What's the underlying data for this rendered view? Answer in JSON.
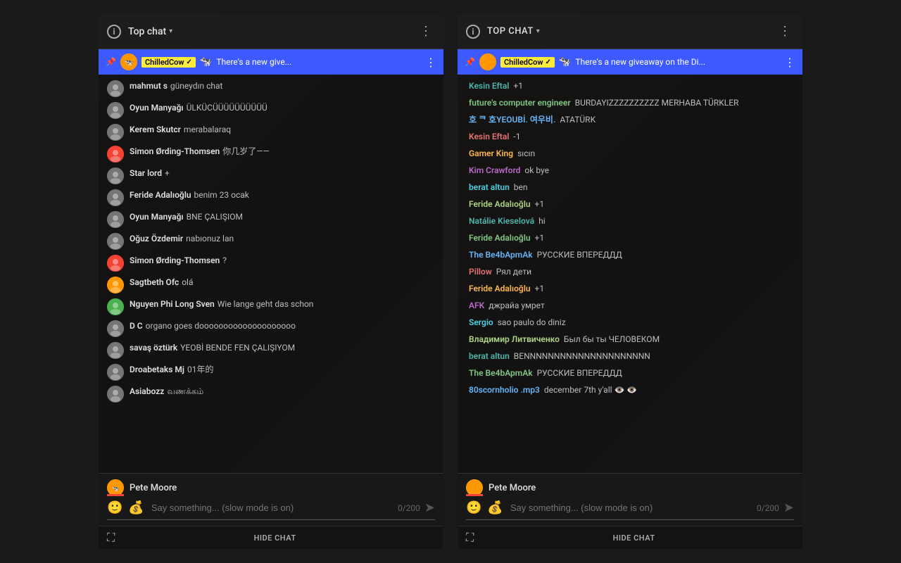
{
  "panel1": {
    "header": {
      "title": "Top chat",
      "dropdown_arrow": "▾",
      "more_dots": "⋮"
    },
    "pinned": {
      "name": "ChilledCow",
      "checkmark": "✓",
      "text": "There's a new give...",
      "emoji": "🐄"
    },
    "messages": [
      {
        "username": "mahmut s",
        "text": "güneydın chat",
        "av_class": "av-gray"
      },
      {
        "username": "Oyun Manyağı",
        "text": "ÜLKÜCÜÜÜÜÜÜÜÜÜÜ",
        "av_class": "av-gray"
      },
      {
        "username": "Kerem Skutcr",
        "text": "merabalaraq",
        "av_class": "av-gray"
      },
      {
        "username": "Simon Ørding-Thomsen",
        "text": "你几岁了——",
        "av_class": "av-red"
      },
      {
        "username": "Star lord",
        "text": "+",
        "av_class": "av-gray"
      },
      {
        "username": "Feride Adalıoğlu",
        "text": "benim 23 ocak",
        "av_class": "av-gray"
      },
      {
        "username": "Oyun Manyağı",
        "text": "BNE ÇALIŞIOM",
        "av_class": "av-gray"
      },
      {
        "username": "Oğuz Özdemir",
        "text": "nabıonuz lan",
        "av_class": "av-gray"
      },
      {
        "username": "Simon Ørding-Thomsen",
        "text": "?",
        "av_class": "av-red"
      },
      {
        "username": "Sagtbeth Ofc",
        "text": "olá",
        "av_class": "av-orange"
      },
      {
        "username": "Nguyen Phi Long Sven",
        "text": "Wie lange geht das schon",
        "av_class": "av-green"
      },
      {
        "username": "D C",
        "text": "organo goes doooooooooooooooooooo",
        "av_class": "av-gray"
      },
      {
        "username": "savaş öztürk",
        "text": "YEOBİ BENDE FEN ÇALIŞIYOM",
        "av_class": "av-gray"
      },
      {
        "username": "Droabetaks Mj",
        "text": "01年的",
        "av_class": "av-gray"
      },
      {
        "username": "Asiabozz",
        "text": "வணக்கம்",
        "av_class": "av-gray"
      }
    ],
    "input": {
      "username": "Pete Moore",
      "placeholder": "Say something... (slow mode is on)",
      "char_count": "0/200"
    },
    "hide_chat": "HIDE CHAT"
  },
  "panel2": {
    "header": {
      "title": "TOP CHAT",
      "dropdown_arrow": "▾",
      "more_dots": "⋮"
    },
    "pinned": {
      "name": "ChilledCow",
      "checkmark": "✓",
      "text": "There's a new giveaway on the Di...",
      "emoji": "🐄"
    },
    "messages": [
      {
        "username": "Kesin Eftal",
        "text": "+1",
        "av_class": null
      },
      {
        "username": "future's computer engineer",
        "text": "BURDAYIZZZZZZZZZZ MERHABA TÜRKLER",
        "av_class": null
      },
      {
        "username": "호 ᄏ 호YEOUBİ. 여우비.",
        "text": "ATATÜRK",
        "av_class": null
      },
      {
        "username": "Kesin Eftal",
        "text": "-1",
        "av_class": null
      },
      {
        "username": "Gamer King",
        "text": "sıcın",
        "av_class": null
      },
      {
        "username": "Kim Crawford",
        "text": "ok bye",
        "av_class": null
      },
      {
        "username": "berat altun",
        "text": "ben",
        "av_class": null
      },
      {
        "username": "Feride Adalıoğlu",
        "text": "+1",
        "av_class": null
      },
      {
        "username": "Natálie Kieselová",
        "text": "hi",
        "av_class": null
      },
      {
        "username": "Feride Adalıoğlu",
        "text": "+1",
        "av_class": null
      },
      {
        "username": "The Be4bApmAk",
        "text": "РУССКИЕ ВПЕРЕДДД",
        "av_class": null
      },
      {
        "username": "Pillow",
        "text": "Рял дети",
        "av_class": null
      },
      {
        "username": "Feride Adalıoğlu",
        "text": "+1",
        "av_class": null
      },
      {
        "username": "AFK",
        "text": "джрайа умрет",
        "av_class": null
      },
      {
        "username": "Sergio",
        "text": "sao paulo do diniz",
        "av_class": null
      },
      {
        "username": "Владимир Литвиченко",
        "text": "Был бы ты ЧЕЛОВЕКОМ",
        "av_class": null
      },
      {
        "username": "berat altun",
        "text": "BENNNNNNNNNNNNNNNNNNNNN",
        "av_class": null
      },
      {
        "username": "The Be4bApmAk",
        "text": "РУССКИЕ ВПЕРЕДДД",
        "av_class": null
      },
      {
        "username": "80scornholio .mp3",
        "text": "december 7th y'all 👁️ 👁️",
        "av_class": null
      }
    ],
    "input": {
      "username": "Pete Moore",
      "placeholder": "Say something... (slow mode is on)",
      "char_count": "0/200"
    },
    "hide_chat": "HIDE CHAT"
  }
}
